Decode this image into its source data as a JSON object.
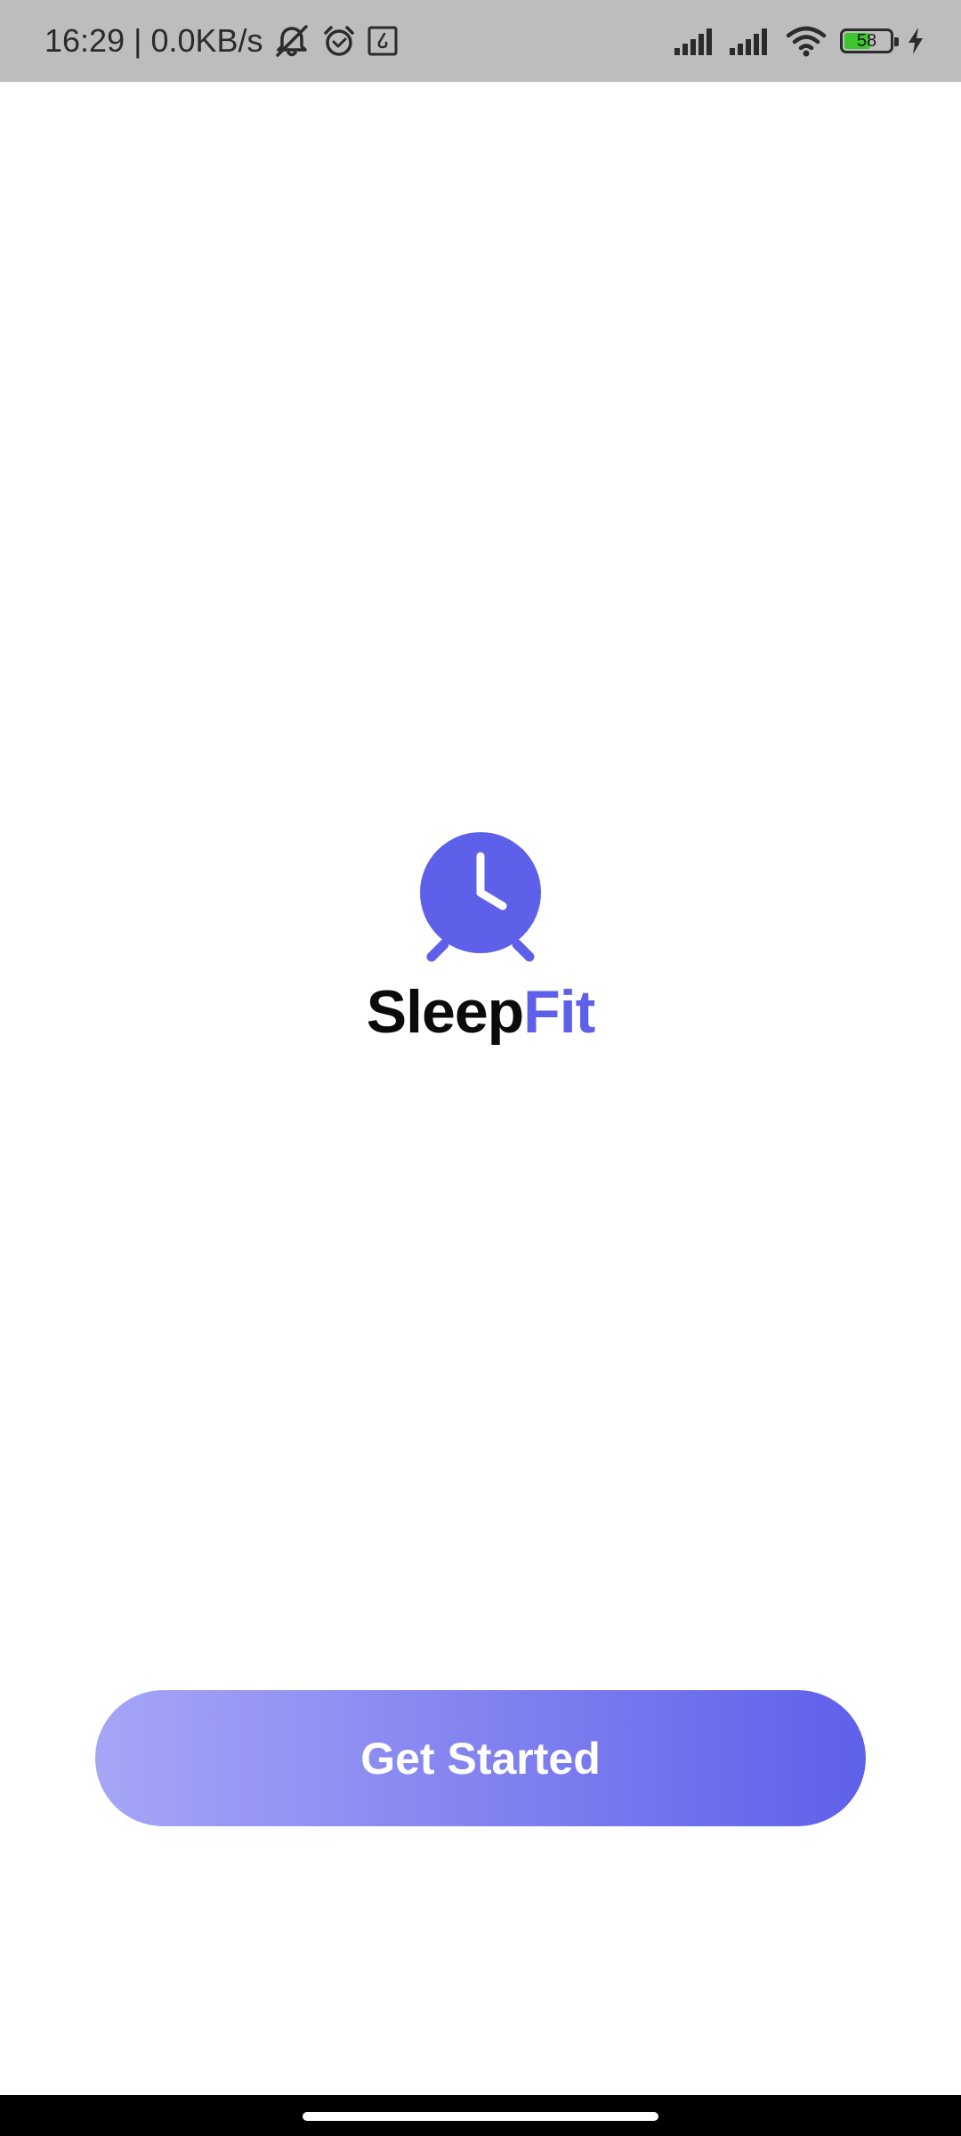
{
  "status_bar": {
    "time": "16:29",
    "separator": "|",
    "net_speed": "0.0KB/s",
    "battery_level": "58",
    "battery_fraction": 0.58,
    "icons_left": [
      "mute-icon",
      "alarm-icon",
      "notification-icon"
    ],
    "icons_right": [
      "signal-icon",
      "signal-icon",
      "wifi-icon",
      "battery-icon",
      "charging-icon"
    ]
  },
  "logo": {
    "icon": "alarm-clock-icon",
    "title_part1": "Sleep",
    "title_part2": "Fit"
  },
  "actions": {
    "get_started_label": "Get Started"
  },
  "colors": {
    "accent": "#5f60ea",
    "button_gradient_start": "#a5a6f6",
    "button_gradient_end": "#5f60ea",
    "status_bar_bg": "#bdbdbd",
    "battery_fill": "#3ec531"
  }
}
